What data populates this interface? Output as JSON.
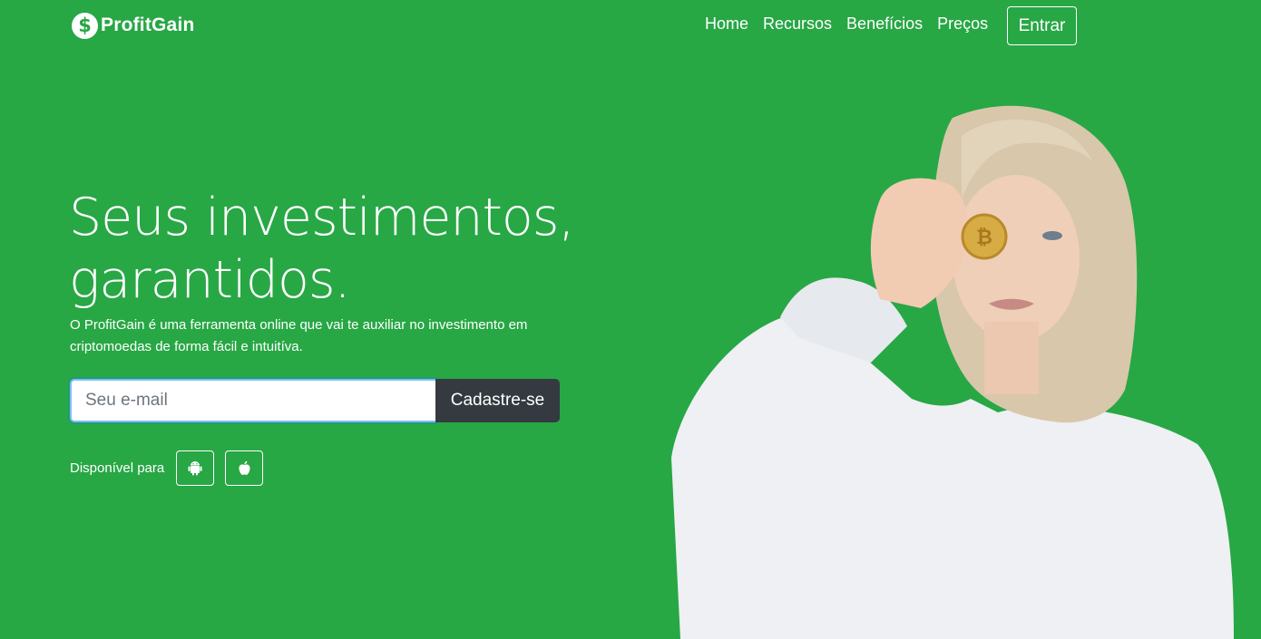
{
  "nav": {
    "brand_symbol": "$",
    "brand": "ProfitGain",
    "links": [
      "Home",
      "Recursos",
      "Benefícios",
      "Preços"
    ],
    "login": "Entrar"
  },
  "hero": {
    "title_line1": "Seus investimentos,",
    "title_line2": "garantidos.",
    "description": "O ProfitGain é uma ferramenta online que vai te auxiliar no investimento em criptomoedas de forma fácil e intuitíva.",
    "email_placeholder": "Seu e-mail",
    "signup_label": "Cadastre-se",
    "available_label": "Disponível para",
    "platform_icons": [
      "android-icon",
      "apple-icon"
    ]
  },
  "colors": {
    "background": "#28a745",
    "button_dark": "#343a40"
  }
}
